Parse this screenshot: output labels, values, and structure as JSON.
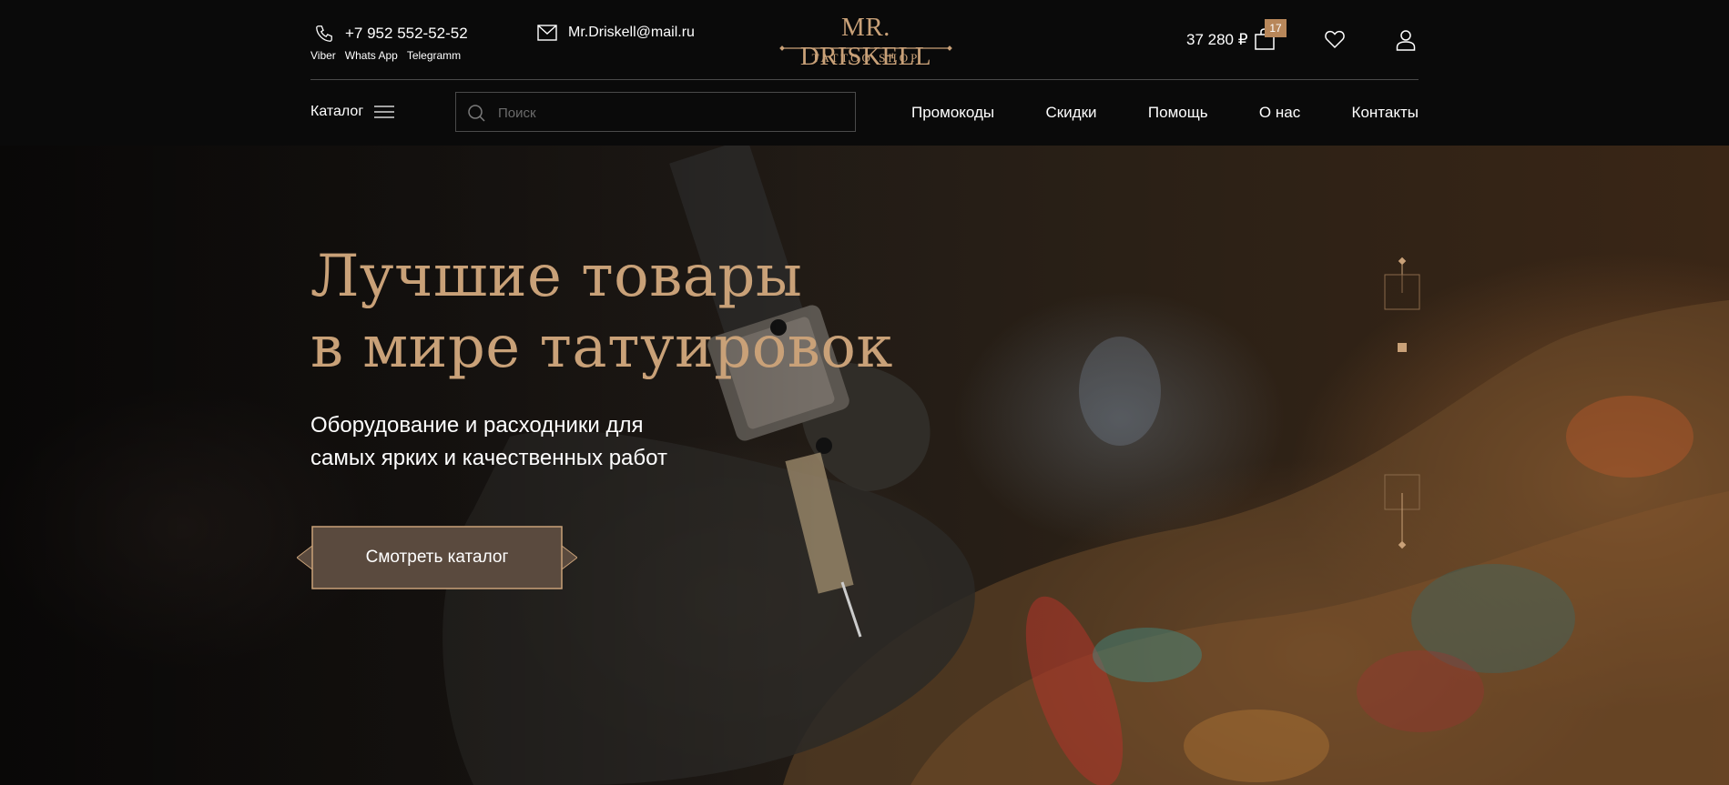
{
  "header": {
    "phone": "+7 952 552-52-52",
    "messengers": [
      "Viber",
      "Whats App",
      "Telegramm"
    ],
    "email": "Mr.Driskell@mail.ru",
    "logo_name": "MR. DRISKELL",
    "logo_sub": "TATTOO SHOP",
    "cart_total": "37 280 ₽",
    "cart_count": "17"
  },
  "nav": {
    "catalog_label": "Каталог",
    "search_placeholder": "Поиск",
    "items": [
      "Промокоды",
      "Скидки",
      "Помощь",
      "О нас",
      "Контакты"
    ]
  },
  "hero": {
    "title_line1": "Лучшие товары",
    "title_line2": "в мире татуировок",
    "subtitle_line1": "Оборудование и расходники для",
    "subtitle_line2": "самых ярких и качественных работ",
    "cta_label": "Смотреть каталог",
    "slides_count": 3,
    "active_slide": 2
  },
  "colors": {
    "accent": "#c9a178",
    "button_fill": "#5a4a3e",
    "badge": "#b8875a",
    "background": "#0a0a0a"
  }
}
